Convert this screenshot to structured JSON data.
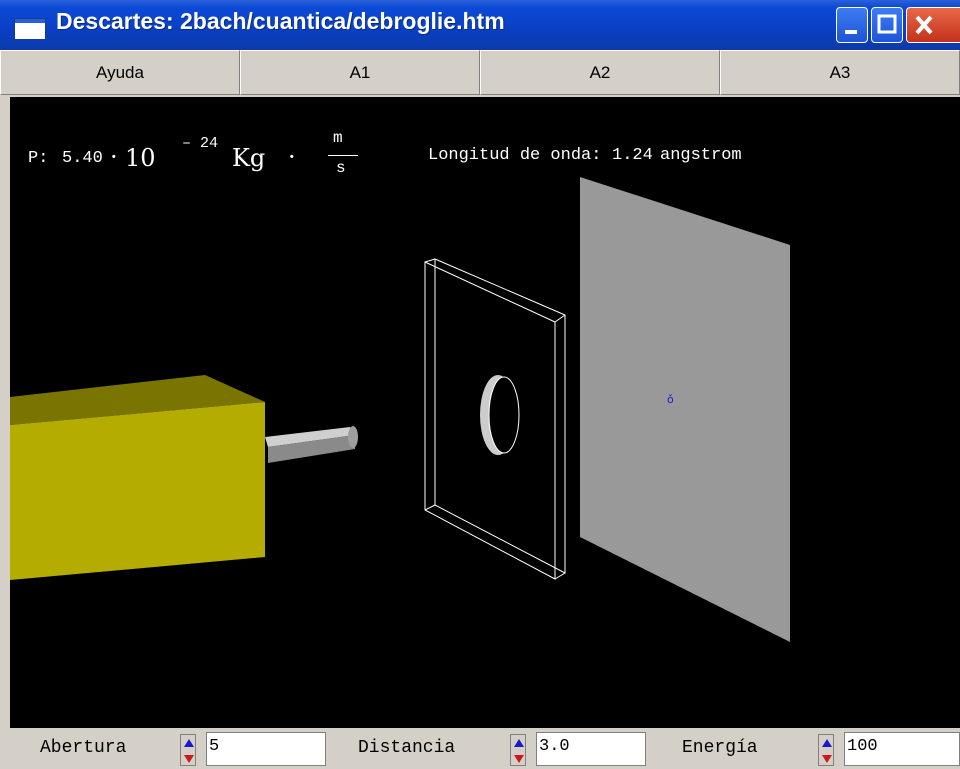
{
  "window": {
    "title": "Descartes: 2bach/cuantica/debroglie.htm"
  },
  "menu": [
    {
      "label": "Ayuda"
    },
    {
      "label": "A1"
    },
    {
      "label": "A2"
    },
    {
      "label": "A3"
    }
  ],
  "readout": {
    "p_label": "P:",
    "p_mantissa": "5.40",
    "p_dot": "·",
    "p_base": "10",
    "p_exp": "– 24",
    "p_unit": "Kg",
    "p_unit_dot": "·",
    "p_num": "m",
    "p_den": "s",
    "wave_label": "Longitud de onda:",
    "wave_value": "1.24",
    "wave_unit": "angstrom"
  },
  "controls": {
    "abertura": {
      "label": "Abertura",
      "value": "5"
    },
    "distancia": {
      "label": "Distancia",
      "value": "3.0"
    },
    "energia": {
      "label": "Energía",
      "value": "100"
    }
  },
  "colors": {
    "gun": "#b4ad00",
    "screen": "#999999",
    "canvas": "#000000"
  }
}
